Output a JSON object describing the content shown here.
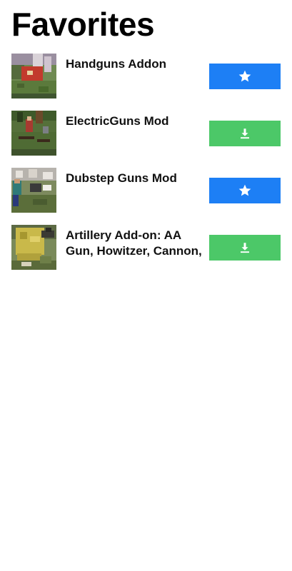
{
  "page": {
    "title": "Favorites"
  },
  "colors": {
    "favorite_button": "#1d7ff5",
    "download_button": "#4cc868",
    "icon": "#ffffff"
  },
  "items": [
    {
      "title": "Handguns Addon",
      "thumbnail": "minecraft-handguns-screenshot",
      "action": "favorite",
      "action_icon": "star-icon"
    },
    {
      "title": "ElectricGuns Mod",
      "thumbnail": "minecraft-electricguns-screenshot",
      "action": "download",
      "action_icon": "download-icon"
    },
    {
      "title": "Dubstep Guns Mod",
      "thumbnail": "minecraft-dubstepguns-screenshot",
      "action": "favorite",
      "action_icon": "star-icon"
    },
    {
      "title": "Artillery Add-on: AA Gun, Howitzer, Cannon,",
      "thumbnail": "minecraft-artillery-screenshot",
      "action": "download",
      "action_icon": "download-icon"
    }
  ]
}
